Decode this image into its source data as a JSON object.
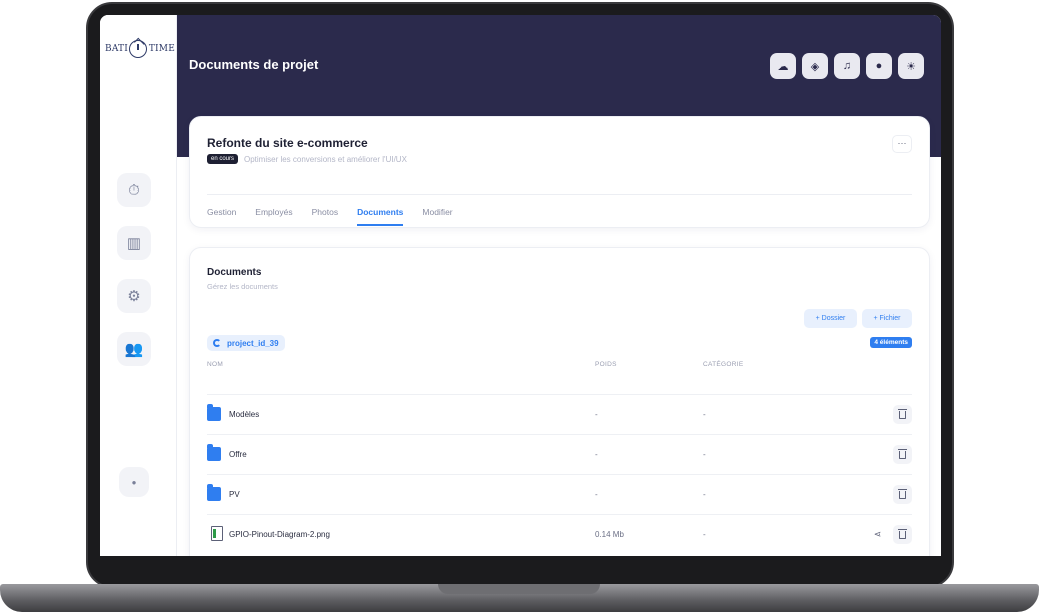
{
  "app": {
    "logo": {
      "left": "BATI",
      "right": "TIME"
    }
  },
  "sidebar": {
    "items": [
      {
        "icon": "timer-icon"
      },
      {
        "icon": "board-icon"
      },
      {
        "icon": "gear-icon"
      },
      {
        "icon": "users-icon"
      }
    ],
    "bottom_icon": "collapse-icon"
  },
  "header": {
    "title": "Documents de projet",
    "icons": [
      "cloud-upload-icon",
      "cube-icon",
      "bell-icon",
      "user-icon",
      "sun-icon"
    ]
  },
  "project": {
    "title": "Refonte du site e-commerce",
    "status_badge": "en cours",
    "subtitle": "Optimiser les conversions et améliorer l'UI/UX",
    "more_label": "···",
    "tabs": [
      {
        "label": "Gestion",
        "active": false
      },
      {
        "label": "Employés",
        "active": false
      },
      {
        "label": "Photos",
        "active": false
      },
      {
        "label": "Documents",
        "active": true
      },
      {
        "label": "Modifier",
        "active": false
      }
    ]
  },
  "documents": {
    "title": "Documents",
    "subtitle": "Gérez les documents",
    "add_folder_label": "+ Dossier",
    "add_file_label": "+ Fichier",
    "path": "project_id_39",
    "count_label": "4 éléments",
    "columns": {
      "name": "NOM",
      "weight": "POIDS",
      "category": "CATÉGORIE"
    },
    "rows": [
      {
        "type": "folder",
        "name": "Modèles",
        "weight": "-",
        "category": "-"
      },
      {
        "type": "folder",
        "name": "Offre",
        "weight": "-",
        "category": "-"
      },
      {
        "type": "folder",
        "name": "PV",
        "weight": "-",
        "category": "-"
      },
      {
        "type": "file",
        "name": "GPIO-Pinout-Diagram-2.png",
        "weight": "0.14 Mb",
        "category": "-"
      }
    ]
  },
  "colors": {
    "header_bg": "#2b2a4c",
    "accent": "#2f7ef0",
    "badge_dark": "#1e2033"
  }
}
